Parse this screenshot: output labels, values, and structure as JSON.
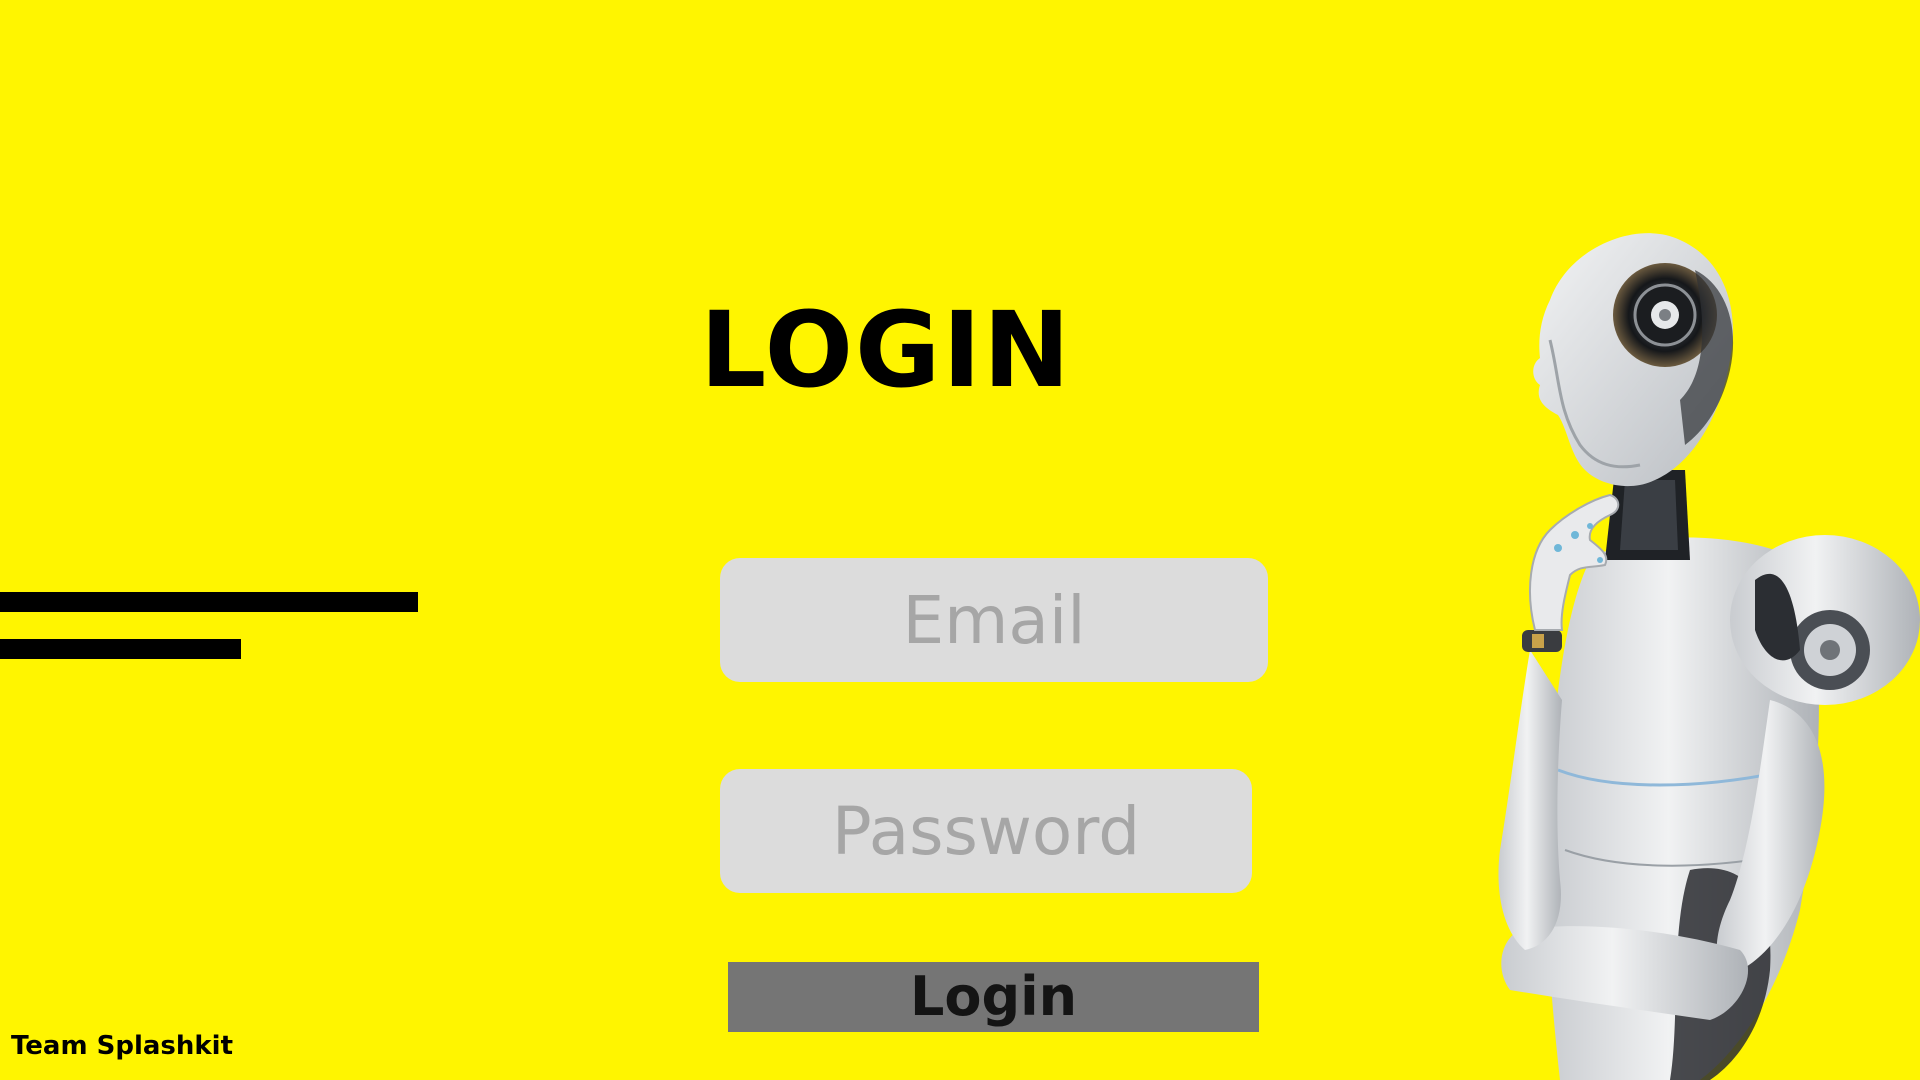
{
  "page": {
    "title": "LOGIN",
    "background_color": "#FFF500",
    "footer_text": "Team Splashkit"
  },
  "form": {
    "email_placeholder": "Email",
    "password_placeholder": "Password",
    "submit_label": "Login",
    "field_color": "#DCDCDC",
    "button_color": "#757575"
  },
  "illustration": {
    "icon": "robot-thinking-illustration"
  }
}
